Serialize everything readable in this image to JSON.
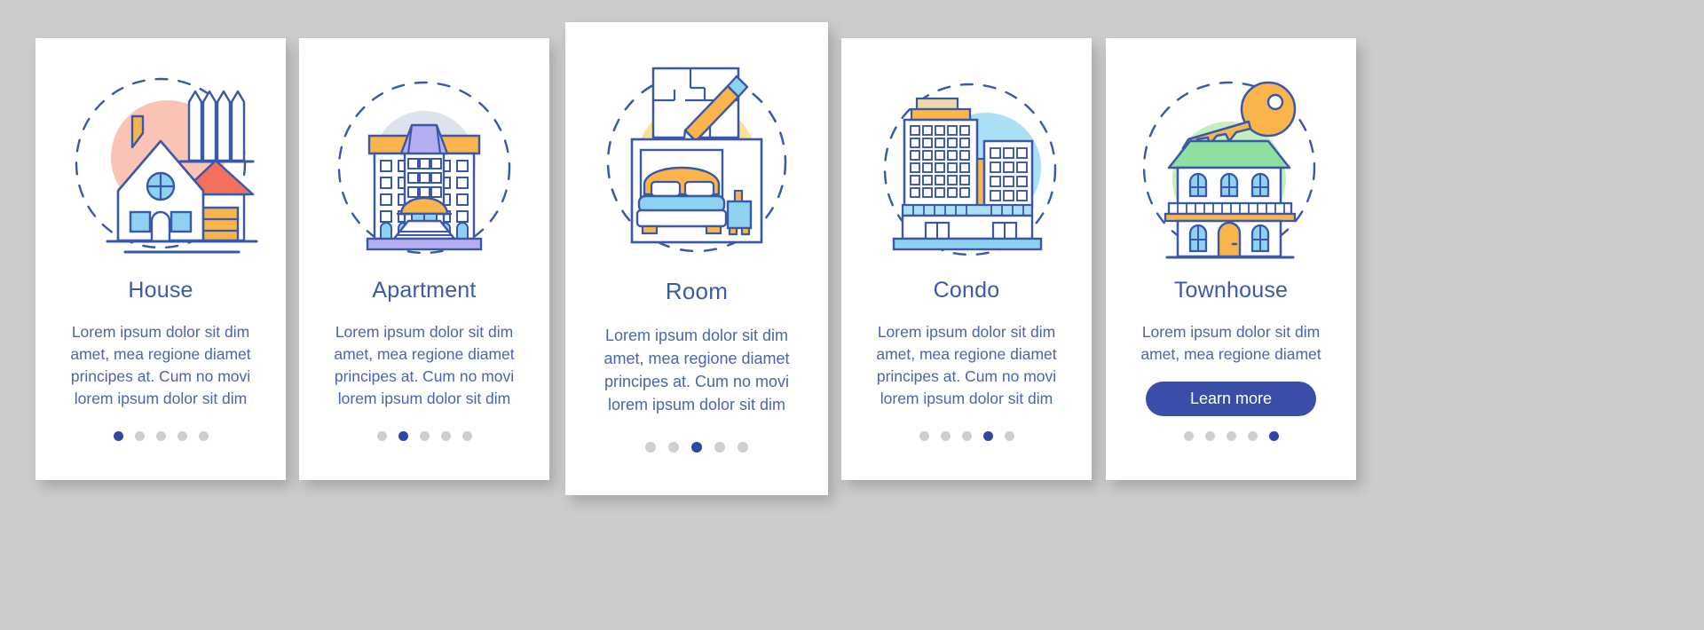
{
  "background_color": "#cccccc",
  "palette": {
    "outline_blue": "#3b57a7",
    "title_blue": "#3c5aa6",
    "body_blue": "#4c64ab",
    "accent_button": "#3a4ea8",
    "dot_active": "#2e47a5",
    "dot_inactive": "#cfcfcf",
    "orange": "#f9b54c",
    "coral": "#f4705c",
    "light_blue": "#8ed2f2",
    "purple": "#b5aef0",
    "green": "#8fe0a0",
    "blob_pink": "#f9c3b6",
    "blob_grey": "#dde3ec",
    "blob_yellow": "#fbdf9a",
    "blob_blue": "#aadff5",
    "blob_green": "#c3eec0"
  },
  "screens": [
    {
      "id": "house",
      "icon": "house-illustration",
      "title": "House",
      "body": "Lorem ipsum dolor sit dim amet, mea regione diamet principes at. Cum no movi lorem ipsum dolor sit dim",
      "dots_total": 5,
      "dot_active_index": 1,
      "has_button": false,
      "button_label": ""
    },
    {
      "id": "apartment",
      "icon": "apartment-illustration",
      "title": "Apartment",
      "body": "Lorem ipsum dolor sit dim amet, mea regione diamet principes at. Cum no movi lorem ipsum dolor sit dim",
      "dots_total": 5,
      "dot_active_index": 2,
      "has_button": false,
      "button_label": ""
    },
    {
      "id": "room",
      "icon": "room-illustration",
      "title": "Room",
      "body": "Lorem ipsum dolor sit dim amet, mea regione diamet principes at. Cum no movi lorem ipsum dolor sit dim",
      "dots_total": 5,
      "dot_active_index": 3,
      "has_button": false,
      "button_label": ""
    },
    {
      "id": "condo",
      "icon": "condo-illustration",
      "title": "Condo",
      "body": "Lorem ipsum dolor sit dim amet, mea regione diamet principes at. Cum no movi lorem ipsum dolor sit dim",
      "dots_total": 5,
      "dot_active_index": 4,
      "has_button": false,
      "button_label": ""
    },
    {
      "id": "townhouse",
      "icon": "townhouse-illustration",
      "title": "Townhouse",
      "body": "Lorem ipsum dolor sit dim amet, mea regione diamet",
      "dots_total": 5,
      "dot_active_index": 5,
      "has_button": true,
      "button_label": "Learn more"
    }
  ]
}
